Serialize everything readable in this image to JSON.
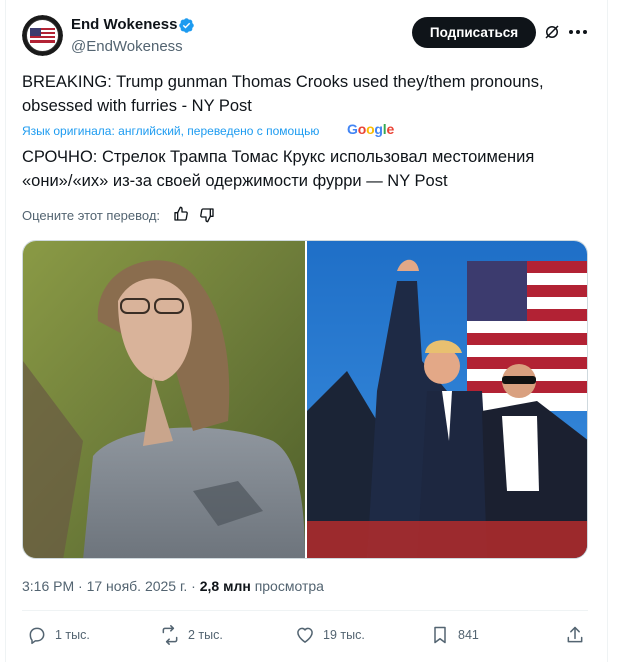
{
  "author": {
    "display_name": "End Wokeness",
    "handle": "@EndWokeness"
  },
  "header": {
    "subscribe_label": "Подписаться"
  },
  "tweet": {
    "original_text": "BREAKING: Trump gunman Thomas Crooks used they/them pronouns, obsessed with furries - NY Post",
    "translation_note": "Язык оригинала: английский, переведено с помощью",
    "translation_provider": "Google",
    "translated_text": "СРОЧНО: Стрелок Трампа Томас Крукс использовал местоимения «они»/«их» из-за своей одержимости фурри — NY Post",
    "rate_translation_label": "Оцените этот перевод:"
  },
  "meta": {
    "time": "3:16 PM",
    "date": "17 нояб. 2025 г.",
    "views_count": "2,8 млн",
    "views_label": "просмотра"
  },
  "actions": {
    "replies": "1 тыс.",
    "reposts": "2 тыс.",
    "likes": "19 тыс.",
    "bookmarks": "841"
  },
  "colors": {
    "accent": "#1d9bf0",
    "text_primary": "#0f1419",
    "text_secondary": "#536471",
    "border": "#eff3f4"
  },
  "icons": [
    "verified-icon",
    "grok-icon",
    "more-icon",
    "thumb-up-icon",
    "thumb-down-icon",
    "reply-icon",
    "repost-icon",
    "like-icon",
    "bookmark-icon",
    "share-icon"
  ]
}
